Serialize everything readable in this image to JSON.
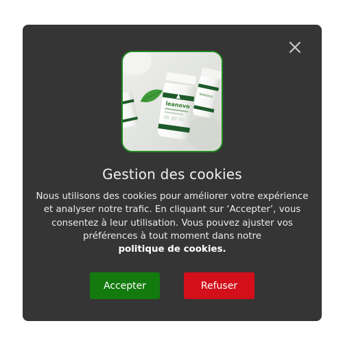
{
  "dialog": {
    "title": "Gestion des cookies",
    "message": "Nous utilisons des cookies pour améliorer votre expérience et analyser notre trafic. En cliquant sur ‘Accepter’, vous consentez à leur utilisation. Vous pouvez ajuster vos préférences à tout moment dans notre",
    "policy_link": "politique de cookies.",
    "close_label": "X",
    "accept_label": "Accepter",
    "refuse_label": "Refuser",
    "product_brand": "leanovo",
    "image": "product-bottles-image"
  },
  "colors": {
    "modal_background": "#353535",
    "accept": "#137a0d",
    "refuse": "#d20f1a",
    "image_border": "#1f8a1f"
  }
}
